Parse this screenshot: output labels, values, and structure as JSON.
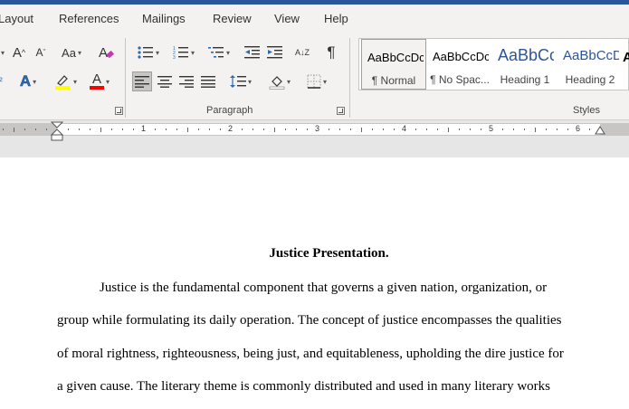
{
  "tabs": [
    "Layout",
    "References",
    "Mailings",
    "Review",
    "View",
    "Help"
  ],
  "ribbon": {
    "font_group": {
      "grow_font": "A",
      "shrink_font": "A",
      "change_case": "Aa",
      "text_effects": "A",
      "font_color": "A"
    },
    "paragraph_group": {
      "label": "Paragraph",
      "sort": "A↓Z",
      "show_marks": "¶"
    },
    "styles_group": {
      "label": "Styles",
      "items": [
        {
          "sample": "AaBbCcDc",
          "name": "¶ Normal",
          "selected": true,
          "color": "#000000"
        },
        {
          "sample": "AaBbCcDc",
          "name": "¶ No Spac...",
          "selected": false,
          "color": "#000000"
        },
        {
          "sample": "AaBbCc",
          "name": "Heading 1",
          "selected": false,
          "color": "#2f5496"
        },
        {
          "sample": "AaBbCcD",
          "name": "Heading 2",
          "selected": false,
          "color": "#2f5496"
        }
      ]
    }
  },
  "ruler": {
    "numbers": [
      "1",
      "2",
      "3",
      "4",
      "5",
      "6"
    ]
  },
  "document": {
    "title": "Justice Presentation.",
    "lines": [
      "Justice is the fundamental component that governs a given nation, organization, or",
      "group while formulating its daily operation. The concept of justice encompasses the qualities",
      "of moral rightness, righteousness, being just, and equitableness, upholding the dire justice for",
      "a given cause. The literary theme is commonly distributed and used in many literary works"
    ]
  },
  "colors": {
    "accent": "#2b579a",
    "highlight": "#ffff00",
    "font_color": "#ff0000",
    "text_effects": "#2b6cb0"
  }
}
